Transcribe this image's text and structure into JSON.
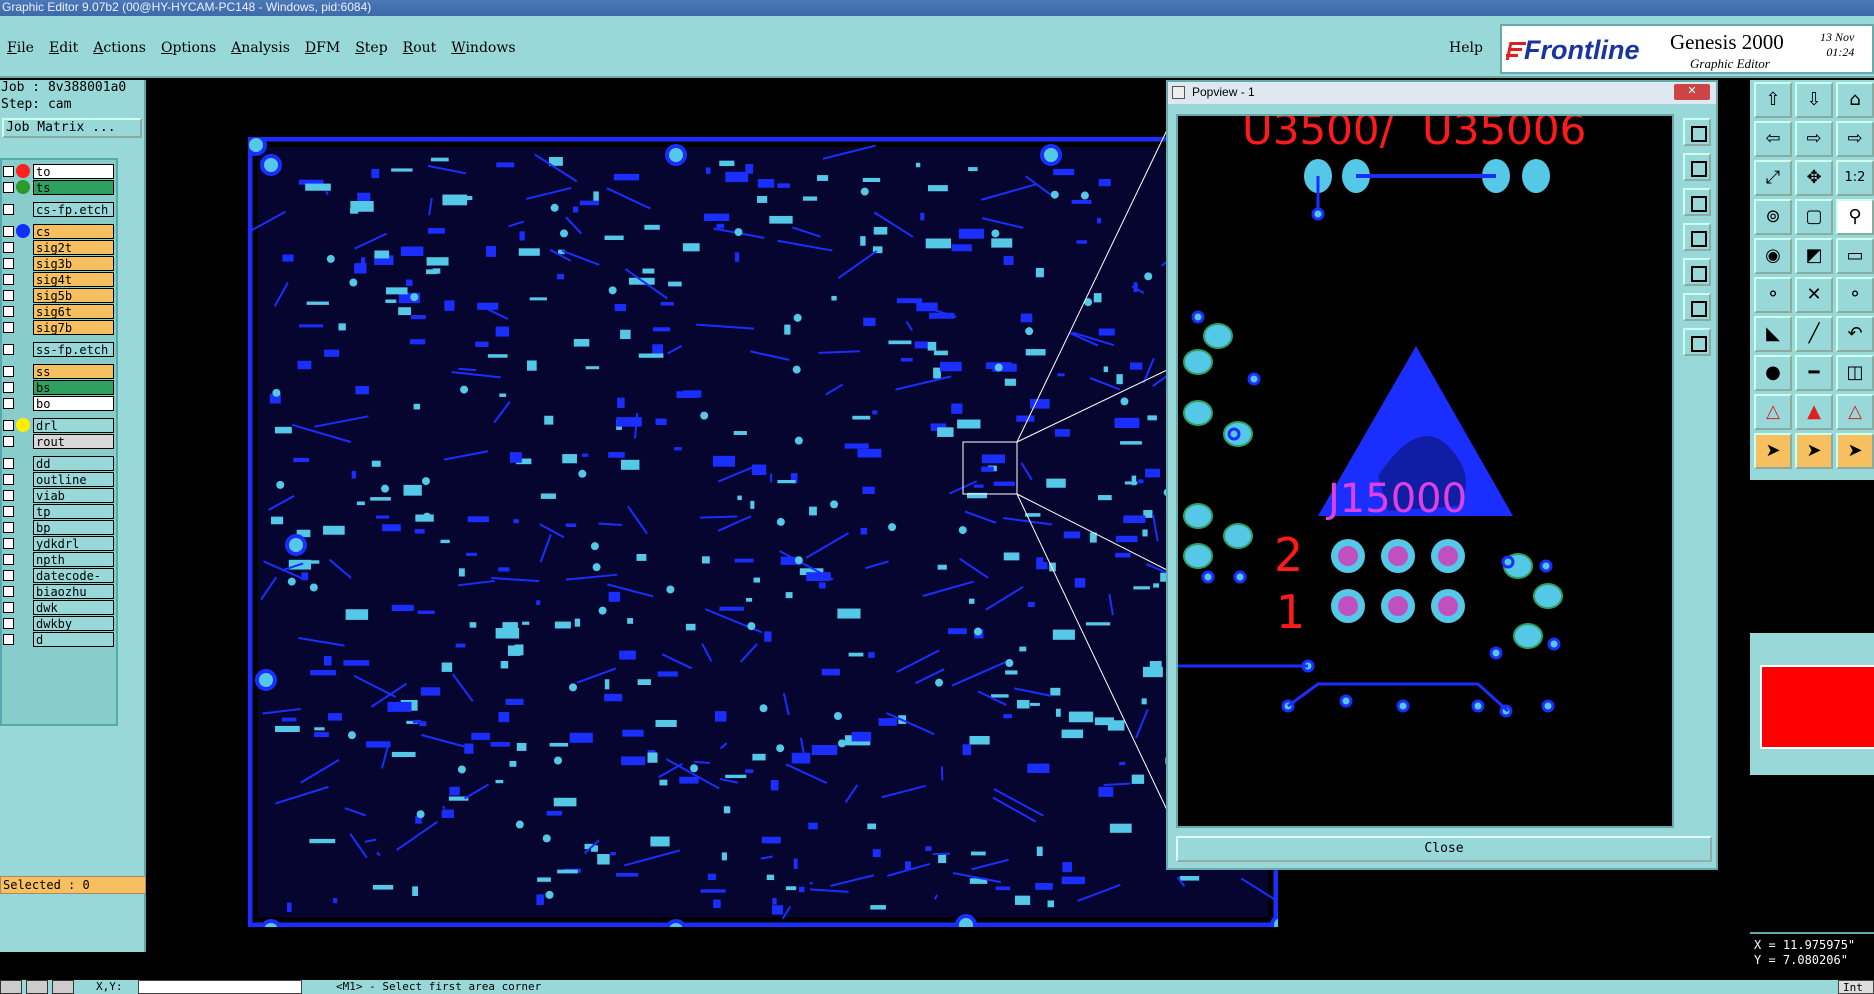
{
  "window": {
    "title": "Graphic Editor 9.07b2 (00@HY-HYCAM-PC148 - Windows, pid:6084)"
  },
  "menu": {
    "items": [
      "File",
      "Edit",
      "Actions",
      "Options",
      "Analysis",
      "DFM",
      "Step",
      "Rout",
      "Windows"
    ],
    "help": "Help"
  },
  "brand": {
    "frontline": "Frontline",
    "genesis": "Genesis 2000",
    "subtitle": "Graphic Editor",
    "date": "13 Nov\n01:24"
  },
  "left": {
    "job": "Job : 8v388001a0",
    "step": "Step: cam",
    "job_matrix": "Job Matrix ...",
    "selected": "Selected : 0"
  },
  "layers": [
    {
      "name": "to",
      "bg": "#ffffff",
      "dot": "#ff2020"
    },
    {
      "name": "ts",
      "bg": "#30a060",
      "dot": "#2a9a2a"
    },
    {
      "gap": true
    },
    {
      "name": "cs-fp.etch",
      "bg": "#98d8d8",
      "dot": ""
    },
    {
      "gap": true
    },
    {
      "name": "cs",
      "bg": "#f6c060",
      "dot": "#1030ff"
    },
    {
      "name": "sig2t",
      "bg": "#f6c060",
      "dot": ""
    },
    {
      "name": "sig3b",
      "bg": "#f6c060",
      "dot": ""
    },
    {
      "name": "sig4t",
      "bg": "#f6c060",
      "dot": ""
    },
    {
      "name": "sig5b",
      "bg": "#f6c060",
      "dot": ""
    },
    {
      "name": "sig6t",
      "bg": "#f6c060",
      "dot": ""
    },
    {
      "name": "sig7b",
      "bg": "#f6c060",
      "dot": ""
    },
    {
      "gap": true
    },
    {
      "name": "ss-fp.etch",
      "bg": "#98d8d8",
      "dot": ""
    },
    {
      "gap": true
    },
    {
      "name": "ss",
      "bg": "#f6c060",
      "dot": ""
    },
    {
      "name": "bs",
      "bg": "#30a060",
      "dot": ""
    },
    {
      "name": "bo",
      "bg": "#ffffff",
      "dot": ""
    },
    {
      "gap": true
    },
    {
      "name": "drl",
      "bg": "#98d8d8",
      "dot": "#ffee00"
    },
    {
      "name": "rout",
      "bg": "#d8d8d8",
      "dot": ""
    },
    {
      "gap": true
    },
    {
      "name": "dd",
      "bg": "#98d8d8",
      "dot": ""
    },
    {
      "name": "outline",
      "bg": "#98d8d8",
      "dot": ""
    },
    {
      "name": "viab",
      "bg": "#98d8d8",
      "dot": ""
    },
    {
      "name": "tp",
      "bg": "#98d8d8",
      "dot": ""
    },
    {
      "name": "bp",
      "bg": "#98d8d8",
      "dot": ""
    },
    {
      "name": "ydkdrl",
      "bg": "#98d8d8",
      "dot": ""
    },
    {
      "name": "npth",
      "bg": "#98d8d8",
      "dot": ""
    },
    {
      "name": "datecode-bs",
      "bg": "#98d8d8",
      "dot": ""
    },
    {
      "name": "biaozhu",
      "bg": "#98d8d8",
      "dot": ""
    },
    {
      "name": "dwk",
      "bg": "#98d8d8",
      "dot": ""
    },
    {
      "name": "dwkby",
      "bg": "#98d8d8",
      "dot": ""
    },
    {
      "name": "d",
      "bg": "#98d8d8",
      "dot": ""
    }
  ],
  "popview": {
    "title": "Popview - 1",
    "close": "Close",
    "labels": {
      "u1": "U3500/",
      "u2": "U35006",
      "j": "J15000",
      "n2": "2",
      "n1": "1"
    }
  },
  "coords": {
    "x": "X = 11.975975\"",
    "y": "Y = 7.080206\""
  },
  "status": {
    "xy": "X,Y:",
    "message": "<M1> - Select first area corner",
    "right": "Int"
  },
  "colors": {
    "panel": "#98d8d8",
    "copper": "#1a2fff",
    "pad": "#55c8e8",
    "text_red": "#ff1a1a"
  }
}
